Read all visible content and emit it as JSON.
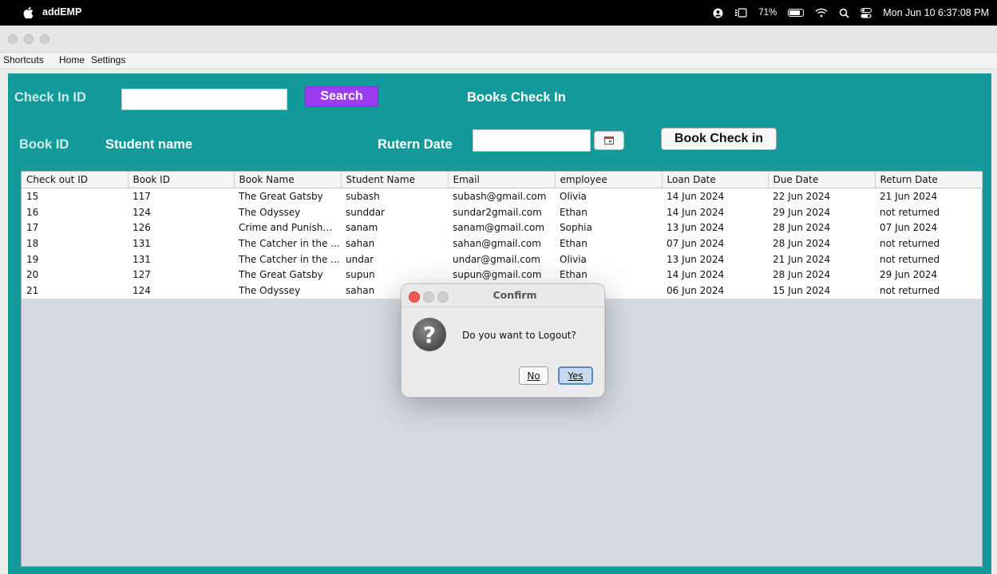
{
  "system_menubar": {
    "app_name": "addEMP",
    "battery_percent": "71%",
    "datetime": "Mon Jun 10  6:37:08 PM"
  },
  "app_menu": [
    "Shortcuts",
    "Home",
    "Settings"
  ],
  "form": {
    "check_in_id_label": "Check In ID",
    "check_in_id_value": "",
    "search_button": "Search",
    "section_title": "Books Check In",
    "book_id_label": "Book ID",
    "student_name_label": "Student name",
    "return_date_label": "Rutern Date",
    "return_date_value": "",
    "book_check_in_button": "Book Check in"
  },
  "table": {
    "columns": [
      "Check out ID",
      "Book ID",
      "Book Name",
      "Student Name",
      "Email",
      "employee",
      "Loan Date",
      "Due Date",
      "Return Date"
    ],
    "rows": [
      [
        "15",
        "117",
        "The Great Gatsby",
        "subash",
        "subash@gmail.com",
        "Olivia",
        "14 Jun 2024",
        "22 Jun 2024",
        "21 Jun 2024"
      ],
      [
        "16",
        "124",
        "The Odyssey",
        "sunddar",
        "sundar2gmail.com",
        "Ethan",
        "14 Jun 2024",
        "29 Jun 2024",
        "not returned"
      ],
      [
        "17",
        "126",
        "Crime and Punishm...",
        "sanam",
        "sanam@gmail.com",
        "Sophia",
        "13 Jun 2024",
        "28 Jun 2024",
        "07 Jun 2024"
      ],
      [
        "18",
        "131",
        "The Catcher in the ...",
        "sahan",
        "sahan@gmail.com",
        "Ethan",
        "07 Jun 2024",
        "28 Jun 2024",
        "not returned"
      ],
      [
        "19",
        "131",
        "The Catcher in the ...",
        "undar",
        "undar@gmail.com",
        "Olivia",
        "13 Jun 2024",
        "21 Jun 2024",
        "not returned"
      ],
      [
        "20",
        "127",
        "The Great Gatsby",
        "supun",
        "supun@gmail.com",
        "Ethan",
        "14 Jun 2024",
        "28 Jun 2024",
        "29 Jun 2024"
      ],
      [
        "21",
        "124",
        "The Odyssey",
        "sahan",
        "",
        "",
        "06 Jun 2024",
        "15 Jun 2024",
        "not returned"
      ]
    ]
  },
  "dialog": {
    "title": "Confirm",
    "message": "Do you want to Logout?",
    "no_button": "No",
    "yes_button": "Yes"
  },
  "colors": {
    "panel_bg": "#149a9a",
    "search_button_bg": "#9b3cf0",
    "table_empty_bg": "#d6dbe3"
  }
}
